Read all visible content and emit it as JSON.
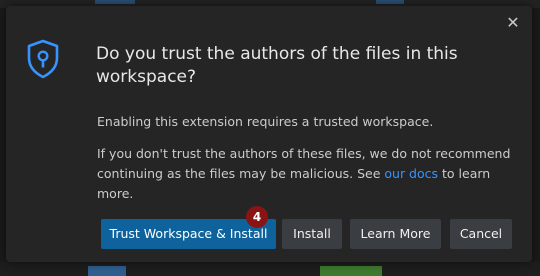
{
  "dialog": {
    "title": "Do you trust the authors of the files in this workspace?",
    "line1": "Enabling this extension requires a trusted workspace.",
    "paragraph_before_link": "If you don't trust the authors of these files, we do not recommend continuing as the files may be malicious. See ",
    "link_text": "our docs",
    "paragraph_after_link": " to learn more.",
    "close_icon": "close-icon",
    "shield_icon": "shield-lock-icon"
  },
  "buttons": {
    "trust_install": "Trust Workspace & Install",
    "install": "Install",
    "learn_more": "Learn More",
    "cancel": "Cancel"
  },
  "badge": {
    "count": "4"
  },
  "colors": {
    "dialog_bg": "#252526",
    "primary_button": "#0e639c",
    "secondary_button": "#3a3d41",
    "link": "#3794ff",
    "badge": "#8a1414",
    "shield": "#3794ff"
  }
}
